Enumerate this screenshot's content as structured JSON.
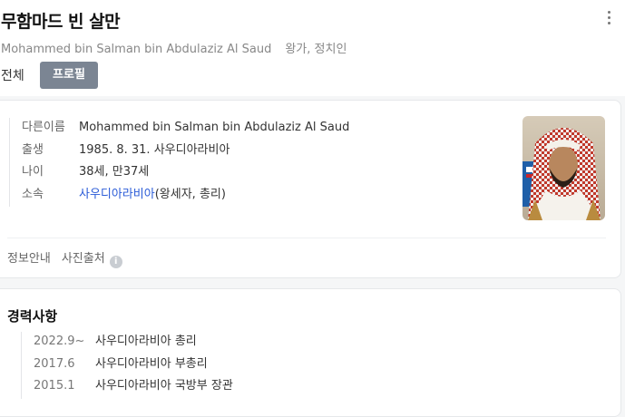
{
  "header": {
    "title": "무함마드 빈 살만",
    "subtitle_name": "Mohammed bin Salman bin Abdulaziz Al Saud",
    "subtitle_role": "왕가, 정치인",
    "more_icon": "more-vertical-icon"
  },
  "tabs": [
    {
      "label": "전체",
      "active": false
    },
    {
      "label": "프로필",
      "active": true
    }
  ],
  "profile": {
    "rows": [
      {
        "key": "다른이름",
        "value": "Mohammed bin Salman bin Abdulaziz Al Saud"
      },
      {
        "key": "출생",
        "value": "1985. 8. 31. 사우디아라비아"
      },
      {
        "key": "나이",
        "value": "38세, 만37세"
      },
      {
        "key": "소속",
        "value_link": "사우디아라비아",
        "value_rest": "(왕세자, 총리)"
      }
    ],
    "footer": {
      "info_label": "정보안내",
      "photo_source_label": "사진출처",
      "info_icon": "info-icon"
    }
  },
  "career": {
    "title": "경력사항",
    "items": [
      {
        "year": "2022.9~",
        "desc": "사우디아라비아 총리"
      },
      {
        "year": "2017.6",
        "desc": "사우디아라비아 부총리"
      },
      {
        "year": "2015.1",
        "desc": "사우디아라비아 국방부 장관"
      }
    ]
  },
  "colors": {
    "link": "#2a5bd7",
    "tab_active_bg": "#7b8593"
  }
}
